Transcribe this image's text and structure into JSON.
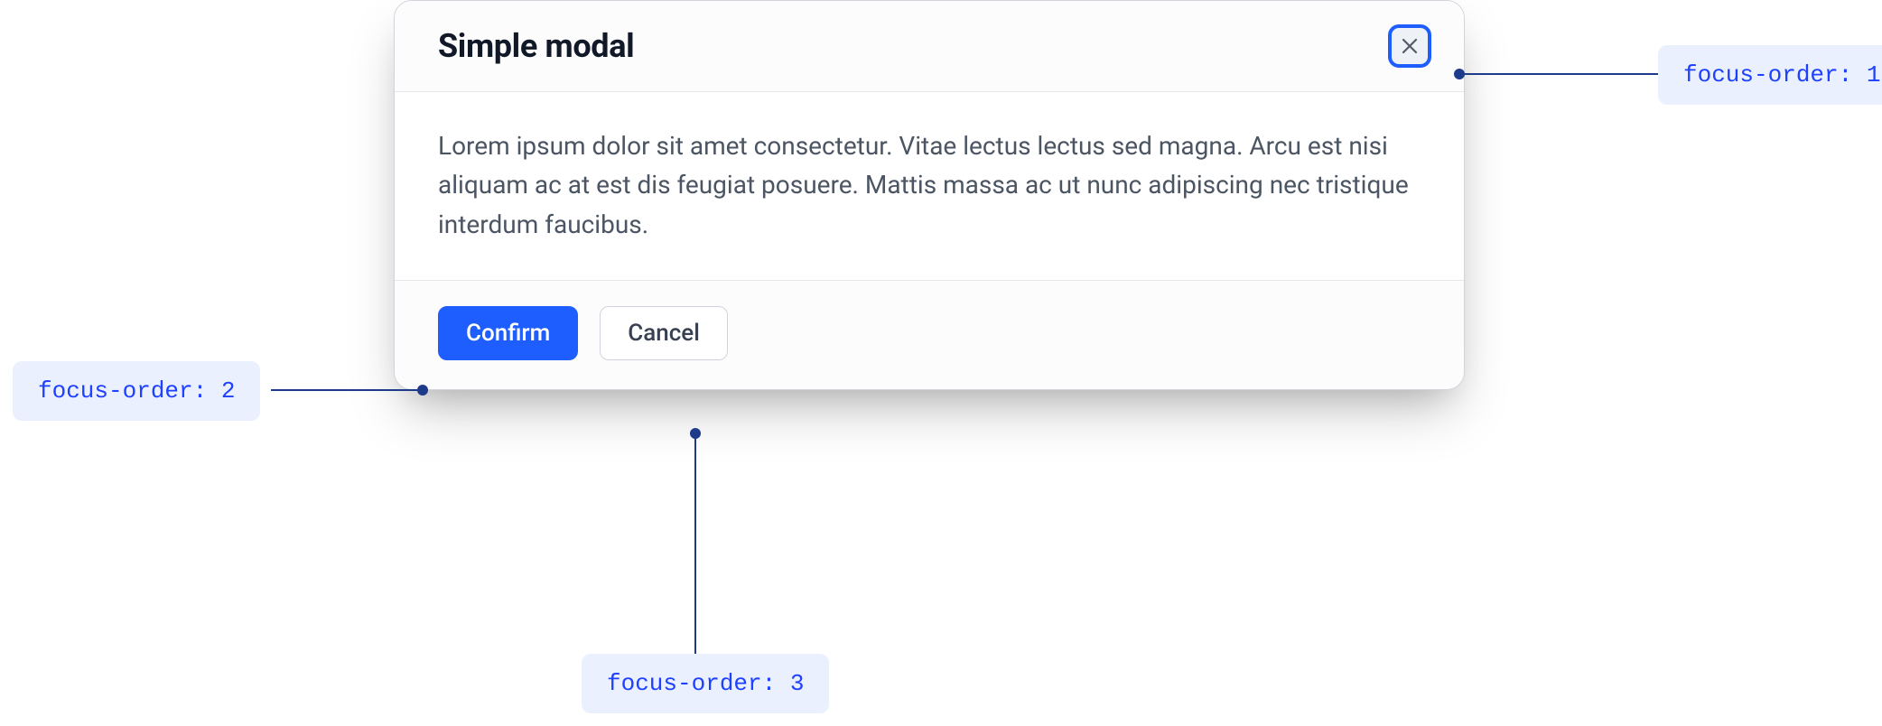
{
  "modal": {
    "title": "Simple modal",
    "body_text": "Lorem ipsum dolor sit amet consectetur. Vitae lectus lectus sed magna. Arcu est nisi aliquam ac at est dis feugiat posuere. Mattis massa ac ut nunc adipiscing nec tristique interdum faucibus.",
    "confirm_label": "Confirm",
    "cancel_label": "Cancel"
  },
  "annotations": {
    "close": "focus-order: 1",
    "confirm": "focus-order: 2",
    "cancel": "focus-order: 3"
  }
}
